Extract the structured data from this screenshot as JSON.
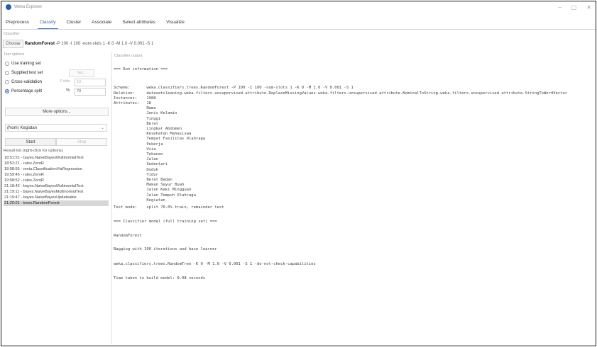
{
  "window": {
    "title": "Weka Explorer",
    "controls": [
      "–",
      "▢",
      "✕"
    ]
  },
  "tabs": [
    "Preprocess",
    "Classify",
    "Cluster",
    "Associate",
    "Select attributes",
    "Visualize"
  ],
  "active_tab": "Classify",
  "classifier": {
    "legend": "Classifier",
    "choose_label": "Choose",
    "name": "RandomForest",
    "options": " -P 100 -I 100 -num-slots 1 -K 0 -M 1.0 -V 0.001 -S 1"
  },
  "test_options": {
    "legend": "Test options",
    "use_training_set": "Use training set",
    "supplied_test_set": "Supplied test set",
    "set_button": "Set...",
    "cross_validation": "Cross-validation",
    "folds_label": "Folds",
    "folds_value": "10",
    "percentage_split": "Percentage split",
    "percent_symbol": "%",
    "percent_value": "70",
    "more_options": "More options..."
  },
  "target_select": "(Nom) Kegiatan",
  "start_label": "Start",
  "stop_label": "Stop",
  "result_list": {
    "legend": "Result list (right-click for options)",
    "items": [
      "18:51:51 - bayes.NaiveBayesMultinomialText",
      "18:52:21 - rules.ZeroR",
      "18:58:55 - meta.ClassificationViaRegression",
      "19:59:45 - rules.ZeroR",
      "19:58:52 - rules.ZeroR",
      "21:18:42 - bayes.NaiveBayesMultinomialText",
      "21:19:11 - bayes.NaiveBayesMultinomialText",
      "21:19:47 - bayes.NaiveBayesUpdateable",
      "21:20:01 - trees.RandomForest"
    ],
    "selected_index": 8
  },
  "output": {
    "legend": "Classifier output",
    "lines": [
      "=== Run information ===",
      "",
      "Scheme:       weka.classifiers.trees.RandomForest -P 100 -I 100 -num-slots 1 -K 0 -M 1.0 -V 0.001 -S 1",
      "Relation:     datasetcleaning-weka.filters.unsupervised.attribute.ReplaceMissingValues-weka.filters.unsupervised.attribute.NominalToString-weka.filters.unsupervised.attribute.StringToWordVector",
      "Instances:    1988",
      "Attributes:   18",
      "              Nama",
      "              Jenis Kelamin",
      "              Tinggi",
      "              Berat",
      "              Lingkar Abdomen",
      "              Kesehatan Mahasiswa",
      "              Tempat Fasilitas Olahraga",
      "              Pekerja",
      "              Usia",
      "              Tekanan",
      "              Jalan",
      "              Sedentari",
      "              Duduk",
      "              Tidur",
      "              Berat Badan",
      "              Makan Sayur Buah",
      "              Jalan Kaki Mingguan",
      "              Jalan Tempuh Olahraga",
      "              Kegiatan",
      "Test mode:    split 70.0% train, remainder test",
      "",
      "=== Classifier model (full training set) ===",
      "",
      "RandomForest",
      "",
      "Bagging with 100 iterations and base learner",
      "",
      "weka.classifiers.trees.RandomTree -K 0 -M 1.0 -V 0.001 -S 1 -do-not-check-capabilities",
      "",
      "Time taken to build model: 0.08 seconds"
    ]
  }
}
